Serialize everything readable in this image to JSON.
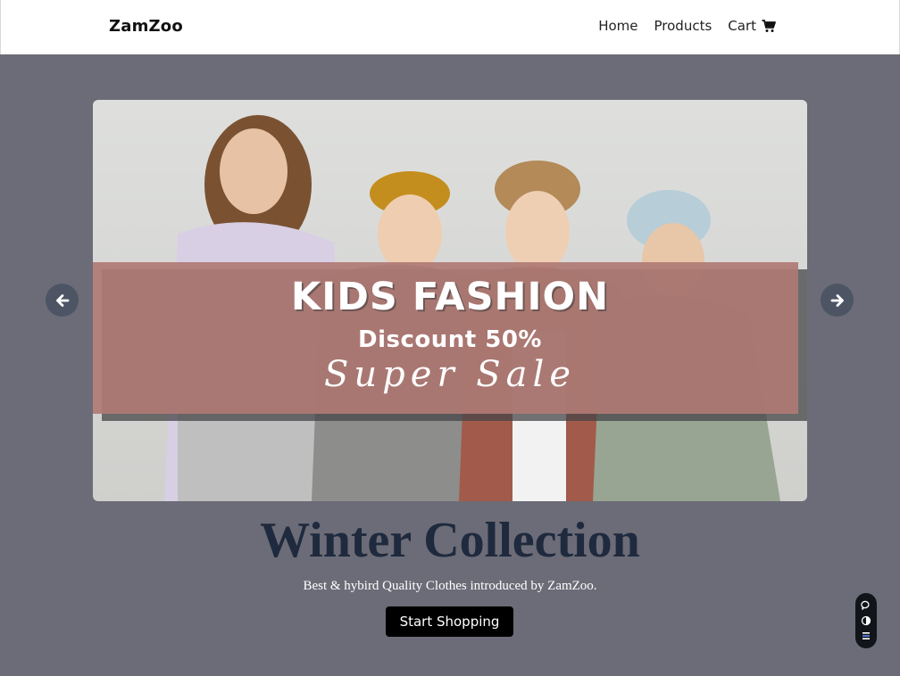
{
  "navbar": {
    "brand": "ZamZoo",
    "links": [
      {
        "label": "Home"
      },
      {
        "label": "Products"
      },
      {
        "label": "Cart",
        "icon": "cart-icon"
      }
    ]
  },
  "carousel": {
    "banner_title": "KIDS FASHION",
    "banner_discount": "Discount 50%",
    "banner_script": "Super Sale",
    "prev_icon": "arrow-left-icon",
    "next_icon": "arrow-right-icon"
  },
  "hero": {
    "title": "Winter Collection",
    "subtitle": "Best & hybird Quality Clothes introduced by ZamZoo.",
    "cta_label": "Start Shopping"
  },
  "widget": {
    "icons": [
      "chat-icon",
      "theme-toggle-icon",
      "list-icon"
    ]
  },
  "colors": {
    "page_background": "#6b6c77",
    "banner": "#b07a74",
    "hero_title": "#1f2a3e",
    "cta_background": "#000000",
    "arrow_button": "#4d5565"
  }
}
